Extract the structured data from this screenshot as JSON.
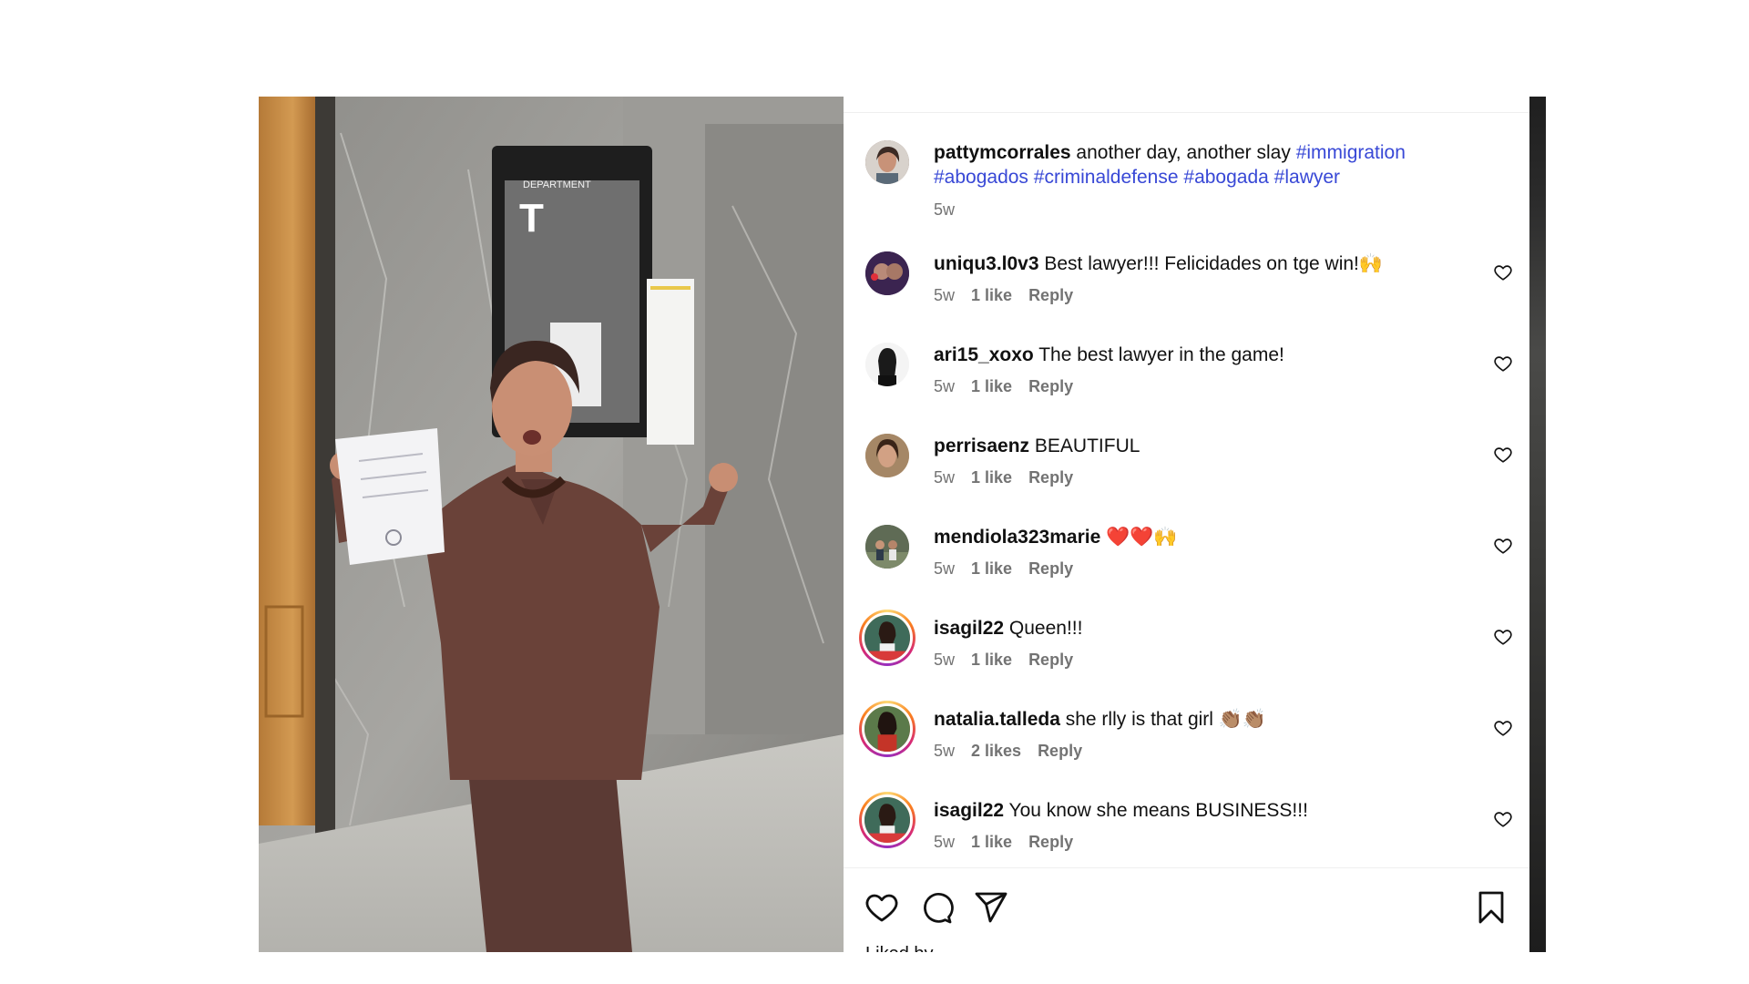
{
  "post": {
    "location_text": "",
    "media": {
      "sign_department": "DEPARTMENT",
      "sign_letter": "T"
    },
    "caption": {
      "username": "pattymcorrales",
      "text": "another day, another slay",
      "hashtags": [
        "#immigration",
        "#abogados",
        "#criminaldefense",
        "#abogada",
        "#lawyer"
      ],
      "time": "5w"
    }
  },
  "comments": [
    {
      "username": "uniqu3.l0v3",
      "text": "Best lawyer!!! Felicidades on tge win!🙌",
      "time": "5w",
      "likes": "1 like",
      "reply": "Reply",
      "ring": false,
      "avatar_color": "#4a2a6a"
    },
    {
      "username": "ari15_xoxo",
      "text": "The best lawyer in the game!",
      "time": "5w",
      "likes": "1 like",
      "reply": "Reply",
      "ring": false,
      "avatar_color": "#f2f2f2"
    },
    {
      "username": "perrisaenz",
      "text": "BEAUTIFUL",
      "time": "5w",
      "likes": "1 like",
      "reply": "Reply",
      "ring": false,
      "avatar_color": "#c9a27a"
    },
    {
      "username": "mendiola323marie",
      "text": "❤️❤️🙌",
      "time": "5w",
      "likes": "1 like",
      "reply": "Reply",
      "ring": false,
      "avatar_color": "#6d7a5e"
    },
    {
      "username": "isagil22",
      "text": "Queen!!!",
      "time": "5w",
      "likes": "1 like",
      "reply": "Reply",
      "ring": true,
      "avatar_color": "#3f6b5a"
    },
    {
      "username": "natalia.talleda",
      "text": "she rlly is that girl 👏🏽👏🏽",
      "time": "5w",
      "likes": "2 likes",
      "reply": "Reply",
      "ring": true,
      "avatar_color": "#a23a2e"
    },
    {
      "username": "isagil22",
      "text": "You know she means BUSINESS!!!",
      "time": "5w",
      "likes": "1 like",
      "reply": "Reply",
      "ring": true,
      "avatar_color": "#3f6b5a"
    }
  ],
  "actions": {
    "like_icon": "heart-outline-icon",
    "comment_icon": "comment-bubble-icon",
    "share_icon": "paper-plane-icon",
    "save_icon": "bookmark-icon"
  },
  "liked_by": "Liked by"
}
